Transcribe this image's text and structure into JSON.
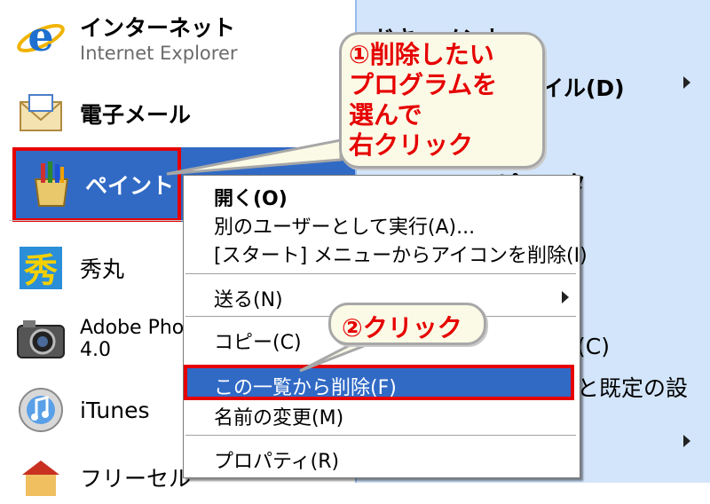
{
  "start_menu": {
    "pinned": [
      {
        "label": "インターネット",
        "sub": "Internet Explorer",
        "icon": "internet-explorer-icon"
      },
      {
        "label": "電子メール",
        "icon": "email-envelope-icon"
      }
    ],
    "recent": [
      {
        "label": "ペイント",
        "icon": "paint-brush-icon",
        "selected": true
      },
      {
        "label": "秀丸",
        "icon": "hidemaru-icon"
      },
      {
        "label": "Adobe Phot",
        "label_line2": "4.0",
        "icon": "camera-icon"
      },
      {
        "label": "iTunes",
        "icon": "itunes-icon"
      },
      {
        "label": "フリーセル",
        "icon": "freecell-icon"
      }
    ],
    "right_pane": [
      {
        "label": "ドキュメント"
      },
      {
        "label": "ファイル(D)",
        "has_submenu": true
      },
      {
        "label": "ピュータ"
      },
      {
        "label": "(C)"
      },
      {
        "label": "と既定の設"
      }
    ]
  },
  "context_menu": {
    "items": [
      {
        "label": "開く(O)",
        "bold": true
      },
      {
        "label": "別のユーザーとして実行(A)..."
      },
      {
        "label": "[スタート] メニューからアイコンを削除(I)"
      },
      {
        "label": "送る(N)",
        "has_submenu": true
      },
      {
        "label": "コピー(C)"
      },
      {
        "label": "この一覧から削除(F)",
        "highlighted": true
      },
      {
        "label": "名前の変更(M)"
      },
      {
        "label": "プロパティ(R)"
      }
    ]
  },
  "annotations": {
    "callout1": [
      "①削除したい",
      "プログラムを",
      "選んで",
      "右クリック"
    ],
    "callout2": "②クリック"
  },
  "colors": {
    "highlight": "#316ac5",
    "annotation_red": "#e60000",
    "right_pane": "#d3e5fa"
  }
}
